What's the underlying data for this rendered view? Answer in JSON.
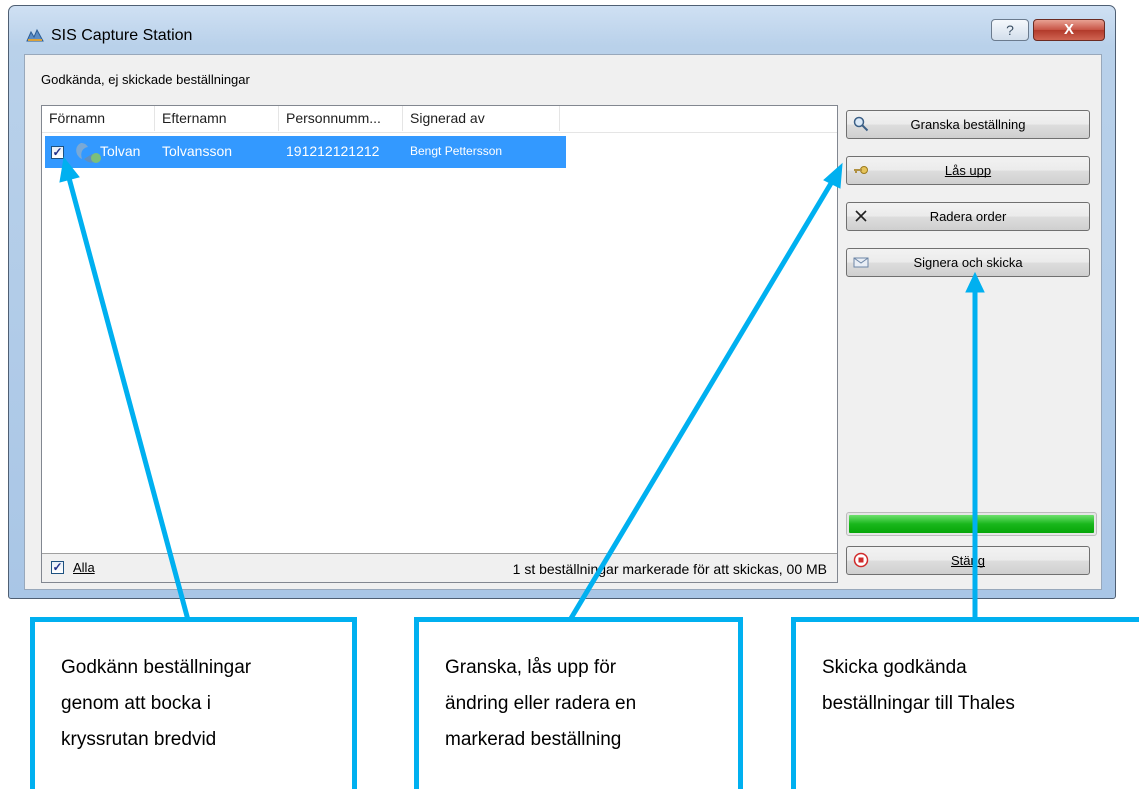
{
  "window": {
    "title": "SIS Capture Station",
    "help_glyph": "?",
    "close_glyph": "X"
  },
  "group_label": "Godkända, ej skickade beställningar",
  "list": {
    "columns": [
      "Förnamn",
      "Efternamn",
      "Personnumm...",
      "Signerad av"
    ],
    "rows": [
      {
        "checked": true,
        "fornamn": "Tolvan",
        "efternamn": "Tolvansson",
        "personnummer": "191212121212",
        "signerad_av": "Bengt Pettersson"
      }
    ],
    "select_all_label": "Alla",
    "select_all_checked": true,
    "status_text": "1 st beställningar markerade för att skickas, 00 MB"
  },
  "buttons": {
    "review": "Granska beställning",
    "unlock": "Lås upp",
    "delete": "Radera order",
    "sign_send": "Signera och skicka",
    "close": "Stäng"
  },
  "progress_value": 1.0,
  "annotations": [
    {
      "lines": [
        "Godkänn beställningar",
        "genom att bocka i",
        "kryssrutan bredvid"
      ]
    },
    {
      "lines": [
        "Granska, lås upp för",
        "ändring eller radera en",
        "markerad beställning"
      ]
    },
    {
      "lines": [
        "Skicka godkända",
        "beställningar till Thales"
      ]
    }
  ],
  "colors": {
    "annotation_accent": "#00b0f0",
    "selection": "#3399ff",
    "progress": "#19b71c"
  }
}
